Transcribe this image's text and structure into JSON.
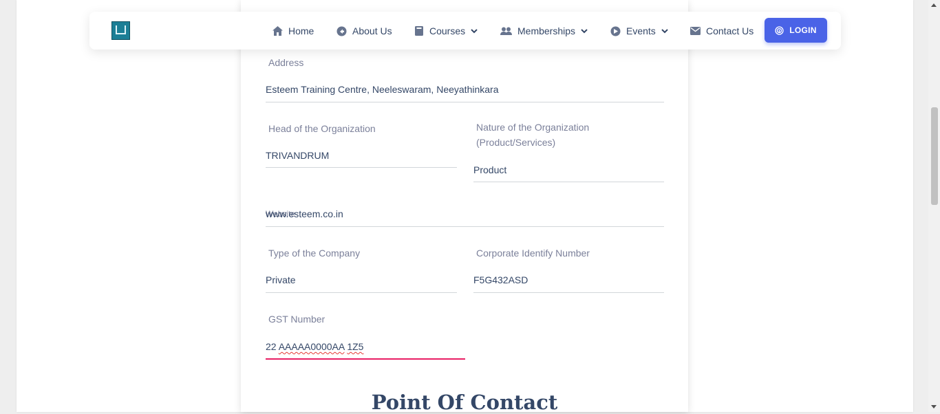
{
  "nav": {
    "items": [
      {
        "label": "Home",
        "icon": "home-icon"
      },
      {
        "label": "About Us",
        "icon": "info-circle-icon"
      },
      {
        "label": "Courses",
        "icon": "book-icon",
        "dropdown": true
      },
      {
        "label": "Memberships",
        "icon": "people-icon",
        "dropdown": true
      },
      {
        "label": "Events",
        "icon": "event-icon",
        "dropdown": true
      },
      {
        "label": "Contact Us",
        "icon": "mail-icon"
      }
    ],
    "login_label": "LOGIN"
  },
  "form": {
    "address": {
      "label": "Address",
      "value": "Esteem Training Centre, Neeleswaram, Neeyathinkara"
    },
    "head": {
      "label": "Head of the Organization",
      "value": "TRIVANDRUM"
    },
    "nature": {
      "label": "Nature of the Organization (Product/Services)",
      "value": "Product"
    },
    "website": {
      "label": "Website",
      "value": "www.esteem.co.in"
    },
    "company_type": {
      "label": "Type of the Company",
      "value": "Private"
    },
    "cin": {
      "label": "Corporate Identify Number",
      "value": "F5G432ASD"
    },
    "gst": {
      "label": "GST Number",
      "value_prefix": "22 ",
      "value_word1": "AAAAA0000AA",
      "value_space": " ",
      "value_word2": "1Z5"
    }
  },
  "section_title": "Point Of Contact",
  "colors": {
    "accent": "#4a63e7",
    "active_underline": "#e91e63",
    "text": "#344767",
    "label": "#7b809a"
  }
}
